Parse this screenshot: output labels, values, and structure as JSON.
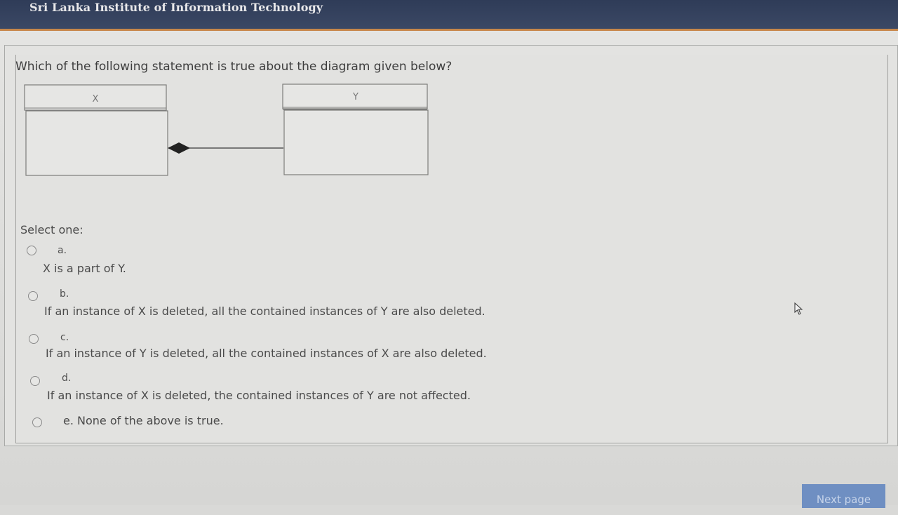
{
  "header": {
    "title": "Sri Lanka Institute of Information Technology"
  },
  "question": {
    "text": "Which of the following statement is true about the diagram given below?",
    "diagram": {
      "class_left": "X",
      "class_right": "Y",
      "relationship": "composition",
      "diamond_on": "X"
    }
  },
  "answers": {
    "prompt": "Select one:",
    "options": [
      {
        "letter": "a.",
        "text": "X is a part of Y.",
        "selected": false
      },
      {
        "letter": "b.",
        "text": "If an instance of X is deleted, all the contained instances of Y are also deleted.",
        "selected": false
      },
      {
        "letter": "c.",
        "text": "If an instance of Y is deleted, all the contained instances of X are also deleted.",
        "selected": false
      },
      {
        "letter": "d.",
        "text": "If an instance of X is deleted, the contained instances of Y are not affected.",
        "selected": false
      },
      {
        "letter": "e.",
        "text": "None of the above is true.",
        "selected": false
      }
    ]
  },
  "navigation": {
    "next_label": "Next page"
  },
  "icons": {
    "cursor": "mouse-pointer-icon"
  },
  "colors": {
    "header": "#34415e",
    "accent": "#c7864a",
    "button": "#6f8fc2"
  }
}
